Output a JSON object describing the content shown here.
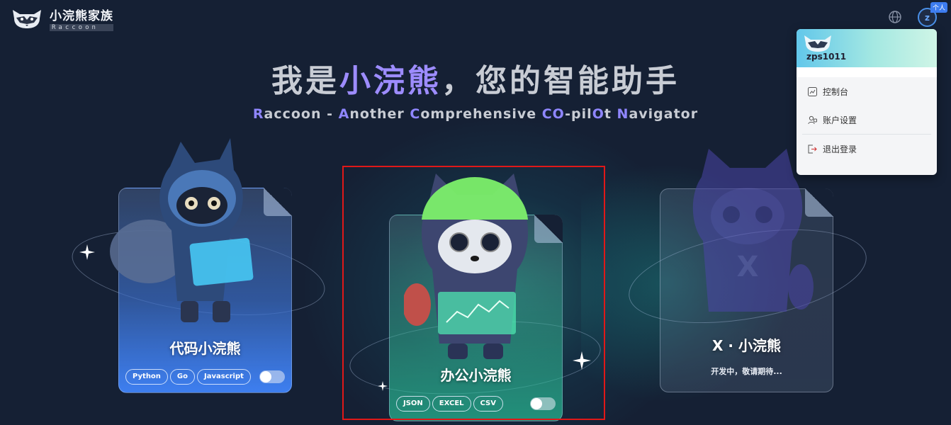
{
  "header": {
    "logo_title": "小浣熊家族",
    "logo_sub": "Raccoon",
    "avatar_letter": "z",
    "avatar_badge": "个人"
  },
  "hero": {
    "title_prefix": "我是",
    "title_highlight": "小浣熊",
    "title_suffix": "，您的智能助手",
    "subtitle_parts": [
      {
        "t": "R",
        "hl": true
      },
      {
        "t": "accoon - ",
        "hl": false
      },
      {
        "t": "A",
        "hl": true
      },
      {
        "t": "nother ",
        "hl": false
      },
      {
        "t": "C",
        "hl": true
      },
      {
        "t": "omprehensive ",
        "hl": false
      },
      {
        "t": "CO",
        "hl": true
      },
      {
        "t": "-pil",
        "hl": false
      },
      {
        "t": "O",
        "hl": true
      },
      {
        "t": "t ",
        "hl": false
      },
      {
        "t": "N",
        "hl": true
      },
      {
        "t": "avigator",
        "hl": false
      }
    ]
  },
  "cards": {
    "code": {
      "name": "代码小浣熊",
      "tags": [
        "Python",
        "Go",
        "Javascript"
      ],
      "enabled": false
    },
    "office": {
      "name": "办公小浣熊",
      "tags": [
        "JSON",
        "EXCEL",
        "CSV"
      ],
      "enabled": false
    },
    "x": {
      "name": "X · 小浣熊",
      "desc": "开发中，敬请期待..."
    }
  },
  "dropdown": {
    "username": "zps1011",
    "items": [
      {
        "label": "控制台",
        "icon": "chart-icon"
      },
      {
        "label": "账户设置",
        "icon": "user-settings-icon"
      },
      {
        "label": "退出登录",
        "icon": "logout-icon"
      }
    ]
  },
  "colors": {
    "background": "#152034",
    "highlight": "#9d8cff",
    "code_card": "#3e7ff0",
    "office_card": "#28be96",
    "selection_border": "#e01818"
  }
}
